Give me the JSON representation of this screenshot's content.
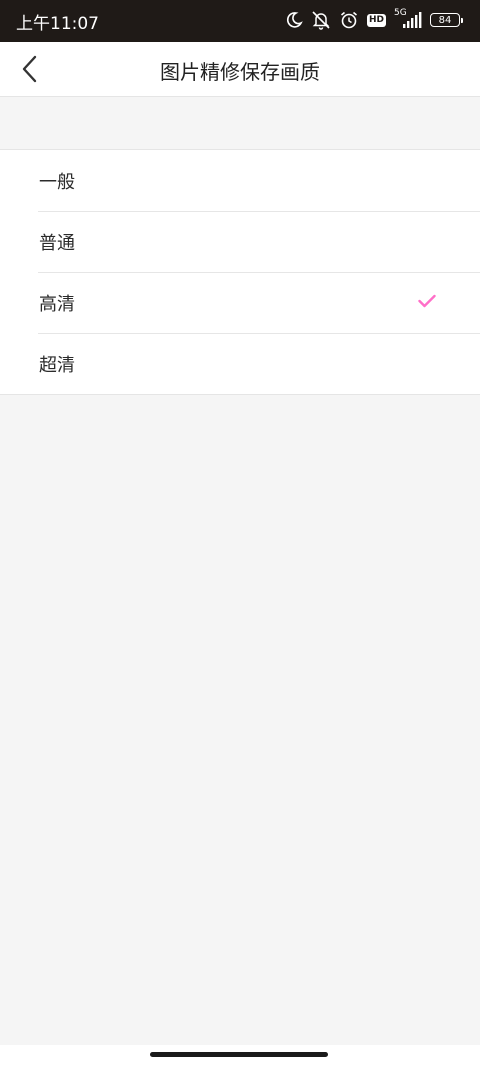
{
  "status_bar": {
    "time": "上午11:07",
    "hd_label": "HD",
    "network_label": "5G",
    "battery_level": "84"
  },
  "header": {
    "title": "图片精修保存画质"
  },
  "options": [
    {
      "label": "一般",
      "selected": false
    },
    {
      "label": "普通",
      "selected": false
    },
    {
      "label": "高清",
      "selected": true
    },
    {
      "label": "超清",
      "selected": false
    }
  ],
  "colors": {
    "accent": "#ff6fc8",
    "status_bar_bg": "#1f1a17",
    "page_bg": "#f5f5f5"
  }
}
